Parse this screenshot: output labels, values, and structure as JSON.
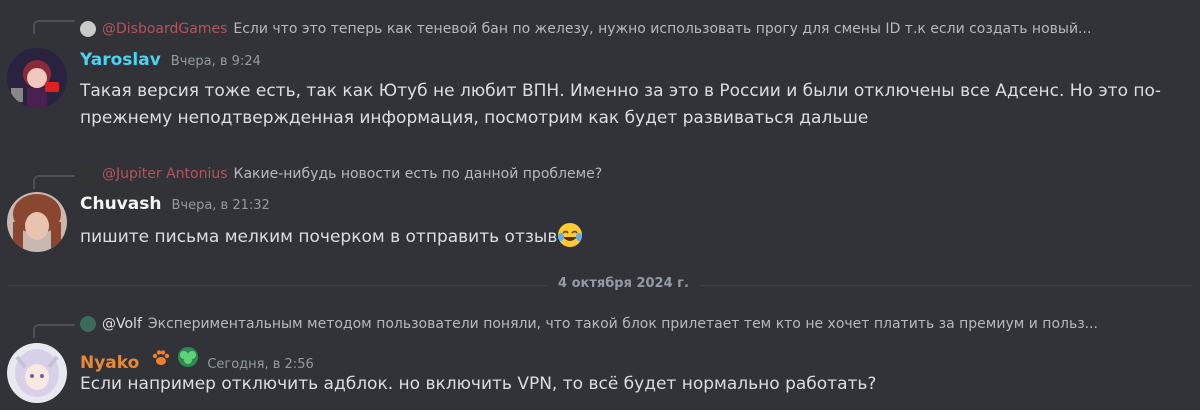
{
  "messages": [
    {
      "reply": {
        "mention": "@DisboardGames",
        "text": "Если что это теперь как теневой бан по железу, нужно использовать прогу для смены ID т.к если создать новый..."
      },
      "author": "Yaroslav",
      "author_color": "#4fd1f0",
      "timestamp": "Вчера, в 9:24",
      "text": "Такая версия тоже есть, так как Ютуб не любит ВПН. Именно за это в России и были отключены все Адсенс. Но это по-прежнему неподтвержденная информация, посмотрим как будет развиваться дальше"
    },
    {
      "reply": {
        "mention": "@Jupiter Antonius",
        "text": "Какие-нибудь новости есть по данной проблеме?"
      },
      "author": "Chuvash",
      "author_color": "#f2f3f5",
      "timestamp": "Вчера, в 21:32",
      "text": "пишите письма мелким почерком в отправить отзыв",
      "emoji": "joy-emoji"
    },
    {
      "reply": {
        "mention": "@Volf",
        "text": "Экспериментальным методом пользователи поняли, что такой блок прилетает тем кто не хочет платить за премиум и польз..."
      },
      "author": "Nyako",
      "author_color": "#e8883a",
      "timestamp": "Сегодня, в 2:56",
      "text": "Если например отключить адблок. но включить VPN, то всё будет нормально работать?"
    }
  ],
  "date_divider": "4 октября 2024 г.",
  "colors": {
    "background": "#313338",
    "divider": "#3f4147",
    "mention": "#b5545c"
  }
}
